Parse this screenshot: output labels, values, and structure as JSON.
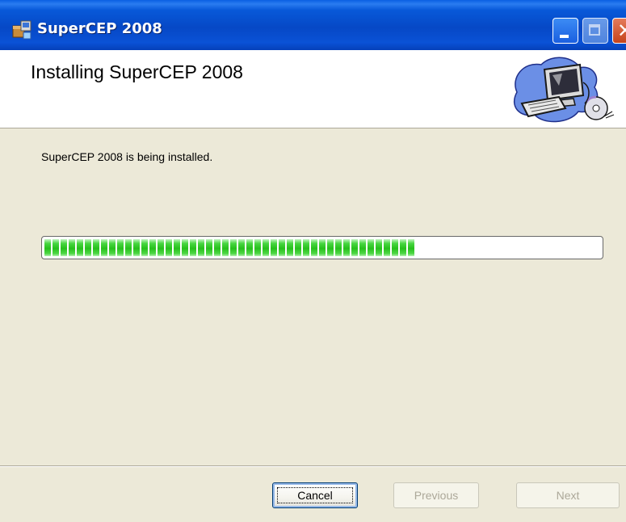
{
  "window": {
    "title": "SuperCEP 2008"
  },
  "banner": {
    "title": "Installing SuperCEP 2008"
  },
  "main": {
    "status_text": "SuperCEP 2008 is being installed.",
    "progress_percent": 67
  },
  "buttons": {
    "cancel": "Cancel",
    "previous": "Previous",
    "next": "Next"
  },
  "colors": {
    "titlebar": "#0648c6",
    "progress": "#27c01c",
    "dialog_bg": "#ece9d8"
  },
  "icons": {
    "app": "installer-box-icon",
    "banner": "computer-cd-icon",
    "minimize": "minimize-icon",
    "maximize": "maximize-icon",
    "close": "close-icon"
  }
}
